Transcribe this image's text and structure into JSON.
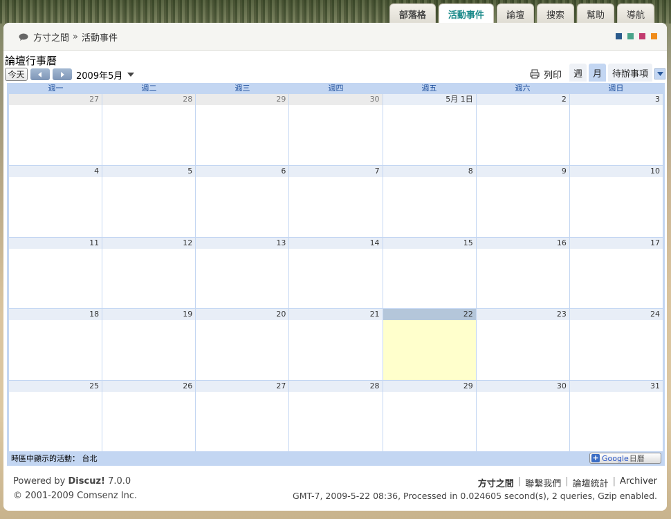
{
  "nav_tabs": [
    {
      "label": "部落格"
    },
    {
      "label": "活動事件"
    },
    {
      "label": "論壇"
    },
    {
      "label": "搜索"
    },
    {
      "label": "幫助"
    },
    {
      "label": "導航"
    }
  ],
  "breadcrumb": {
    "home": "方寸之間",
    "separator": "»",
    "current": "活動事件"
  },
  "theme_swatches": [
    "#2a5a8c",
    "#4aa38a",
    "#c23a6e",
    "#f08c1a"
  ],
  "calendar": {
    "title": "論壇行事曆",
    "today_button": "今天",
    "month_label": "2009年5月",
    "print_label": "列印",
    "view_tabs": {
      "week": "週",
      "month": "月",
      "agenda": "待辦事項"
    },
    "weekdays": [
      "週一",
      "週二",
      "週三",
      "週四",
      "週五",
      "週六",
      "週日"
    ],
    "weeks": [
      [
        {
          "d": "27",
          "o": true
        },
        {
          "d": "28",
          "o": true
        },
        {
          "d": "29",
          "o": true
        },
        {
          "d": "30",
          "o": true
        },
        {
          "d": "5月 1日"
        },
        {
          "d": "2"
        },
        {
          "d": "3"
        }
      ],
      [
        {
          "d": "4"
        },
        {
          "d": "5"
        },
        {
          "d": "6"
        },
        {
          "d": "7"
        },
        {
          "d": "8"
        },
        {
          "d": "9"
        },
        {
          "d": "10"
        }
      ],
      [
        {
          "d": "11"
        },
        {
          "d": "12"
        },
        {
          "d": "13"
        },
        {
          "d": "14"
        },
        {
          "d": "15"
        },
        {
          "d": "16"
        },
        {
          "d": "17"
        }
      ],
      [
        {
          "d": "18"
        },
        {
          "d": "19"
        },
        {
          "d": "20"
        },
        {
          "d": "21"
        },
        {
          "d": "22",
          "t": true
        },
        {
          "d": "23"
        },
        {
          "d": "24"
        }
      ],
      [
        {
          "d": "25"
        },
        {
          "d": "26"
        },
        {
          "d": "27"
        },
        {
          "d": "28"
        },
        {
          "d": "29"
        },
        {
          "d": "30"
        },
        {
          "d": "31"
        }
      ]
    ],
    "timezone_text": "時區中顯示的活動： 台北",
    "gcal_button": {
      "google": "Google",
      "suffix": "日曆"
    }
  },
  "footer": {
    "powered_prefix": "Powered by",
    "product": "Discuz!",
    "version": "7.0.0",
    "copyright": "© 2001-2009 Comsenz Inc.",
    "links": [
      "方寸之間",
      "聯繫我們",
      "論壇統計",
      "Archiver"
    ],
    "stats": "GMT-7, 2009-5-22 08:36, Processed in 0.024605 second(s), 2 queries, Gzip enabled."
  }
}
